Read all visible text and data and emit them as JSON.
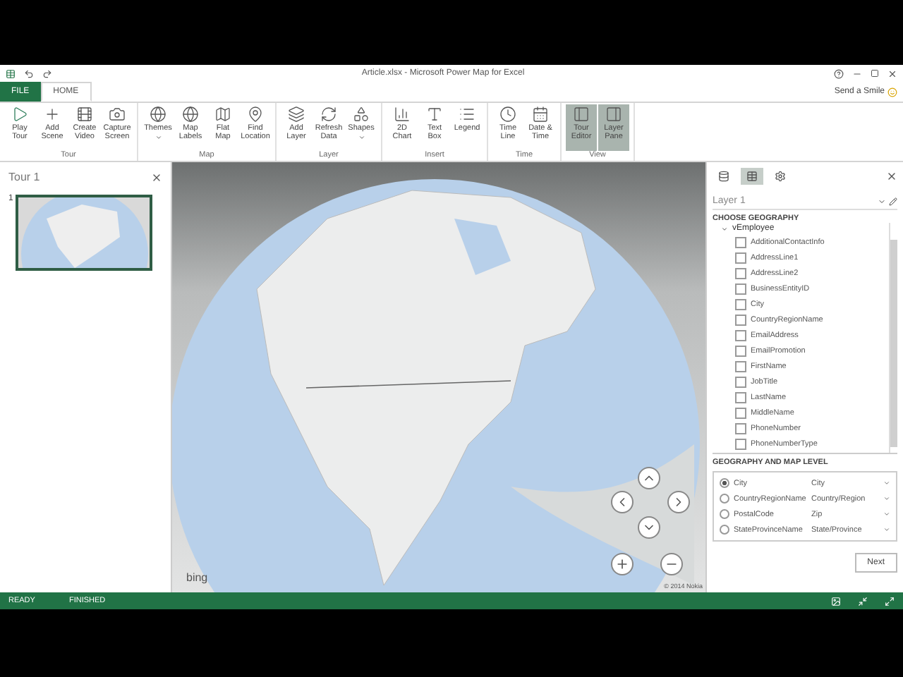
{
  "window": {
    "title": "Article.xlsx - Microsoft Power Map for Excel"
  },
  "ribbon_tabs": [
    {
      "label": "FILE",
      "kind": "file",
      "selected": false
    },
    {
      "label": "HOME",
      "kind": "tab",
      "selected": true
    }
  ],
  "account": {
    "label": "Send a Smile"
  },
  "ribbon_groups": [
    {
      "name": "Tour",
      "buttons": [
        {
          "label": "Play Tour",
          "kind": "play",
          "dropdown": false,
          "selected": false
        },
        {
          "label": "Add Scene",
          "kind": "plus",
          "dropdown": false,
          "selected": false
        },
        {
          "label": "Create Video",
          "kind": "video",
          "dropdown": false,
          "selected": false
        },
        {
          "label": "Capture Screen",
          "kind": "camera",
          "dropdown": false,
          "selected": false
        }
      ]
    },
    {
      "name": "Map",
      "buttons": [
        {
          "label": "Themes",
          "kind": "globe",
          "dropdown": true,
          "selected": false
        },
        {
          "label": "Map Labels",
          "kind": "globe",
          "dropdown": false,
          "selected": false
        },
        {
          "label": "Flat Map",
          "kind": "map",
          "dropdown": false,
          "selected": false
        },
        {
          "label": "Find Location",
          "kind": "pin",
          "dropdown": false,
          "selected": false
        }
      ]
    },
    {
      "name": "Layer",
      "buttons": [
        {
          "label": "Add Layer",
          "kind": "layers",
          "dropdown": false,
          "selected": false
        },
        {
          "label": "Refresh Data",
          "kind": "refresh",
          "dropdown": false,
          "selected": false
        },
        {
          "label": "Shapes",
          "kind": "shapes",
          "dropdown": true,
          "selected": false
        }
      ]
    },
    {
      "name": "Insert",
      "buttons": [
        {
          "label": "2D Chart",
          "kind": "chart",
          "dropdown": false,
          "selected": false
        },
        {
          "label": "Text Box",
          "kind": "text",
          "dropdown": false,
          "selected": false
        },
        {
          "label": "Legend",
          "kind": "list",
          "dropdown": false,
          "selected": false
        }
      ]
    },
    {
      "name": "Time",
      "buttons": [
        {
          "label": "Time Line",
          "kind": "clock",
          "dropdown": false,
          "selected": false
        },
        {
          "label": "Date & Time",
          "kind": "calendar",
          "dropdown": false,
          "selected": false
        }
      ]
    },
    {
      "name": "View",
      "buttons": [
        {
          "label": "Tour Editor",
          "kind": "panel-left",
          "dropdown": false,
          "selected": true
        },
        {
          "label": "Layer Pane",
          "kind": "panel-right",
          "dropdown": false,
          "selected": true
        }
      ]
    }
  ],
  "tour_panel": {
    "title": "Tour 1",
    "scenes": [
      {
        "number": "1",
        "selected": true
      }
    ]
  },
  "map": {
    "logo": "bing",
    "copyright": "© 2014 Nokia"
  },
  "layer_pane": {
    "tabs": [
      {
        "kind": "layers",
        "selected": false
      },
      {
        "kind": "fields",
        "selected": true
      },
      {
        "kind": "settings",
        "selected": false
      }
    ],
    "layer_name": "Layer 1",
    "section_title": "CHOOSE GEOGRAPHY",
    "table": {
      "name": "vEmployee",
      "expanded": true,
      "fields": [
        {
          "label": "AdditionalContactInfo",
          "checked": false
        },
        {
          "label": "AddressLine1",
          "checked": false
        },
        {
          "label": "AddressLine2",
          "checked": false
        },
        {
          "label": "BusinessEntityID",
          "checked": false
        },
        {
          "label": "City",
          "checked": false
        },
        {
          "label": "CountryRegionName",
          "checked": false
        },
        {
          "label": "EmailAddress",
          "checked": false
        },
        {
          "label": "EmailPromotion",
          "checked": false
        },
        {
          "label": "FirstName",
          "checked": false
        },
        {
          "label": "JobTitle",
          "checked": false
        },
        {
          "label": "LastName",
          "checked": false
        },
        {
          "label": "MiddleName",
          "checked": false
        },
        {
          "label": "PhoneNumber",
          "checked": false
        },
        {
          "label": "PhoneNumberType",
          "checked": false
        }
      ]
    },
    "levels_title": "GEOGRAPHY AND MAP LEVEL",
    "levels": [
      {
        "field": "City",
        "level": "City",
        "selected": true
      },
      {
        "field": "CountryRegionName",
        "level": "Country/Region",
        "selected": false
      },
      {
        "field": "PostalCode",
        "level": "Zip",
        "selected": false
      },
      {
        "field": "StateProvinceName",
        "level": "State/Province",
        "selected": false
      }
    ],
    "next_button": "Next"
  },
  "status_bar": {
    "left": "READY",
    "right": "FINISHED"
  }
}
